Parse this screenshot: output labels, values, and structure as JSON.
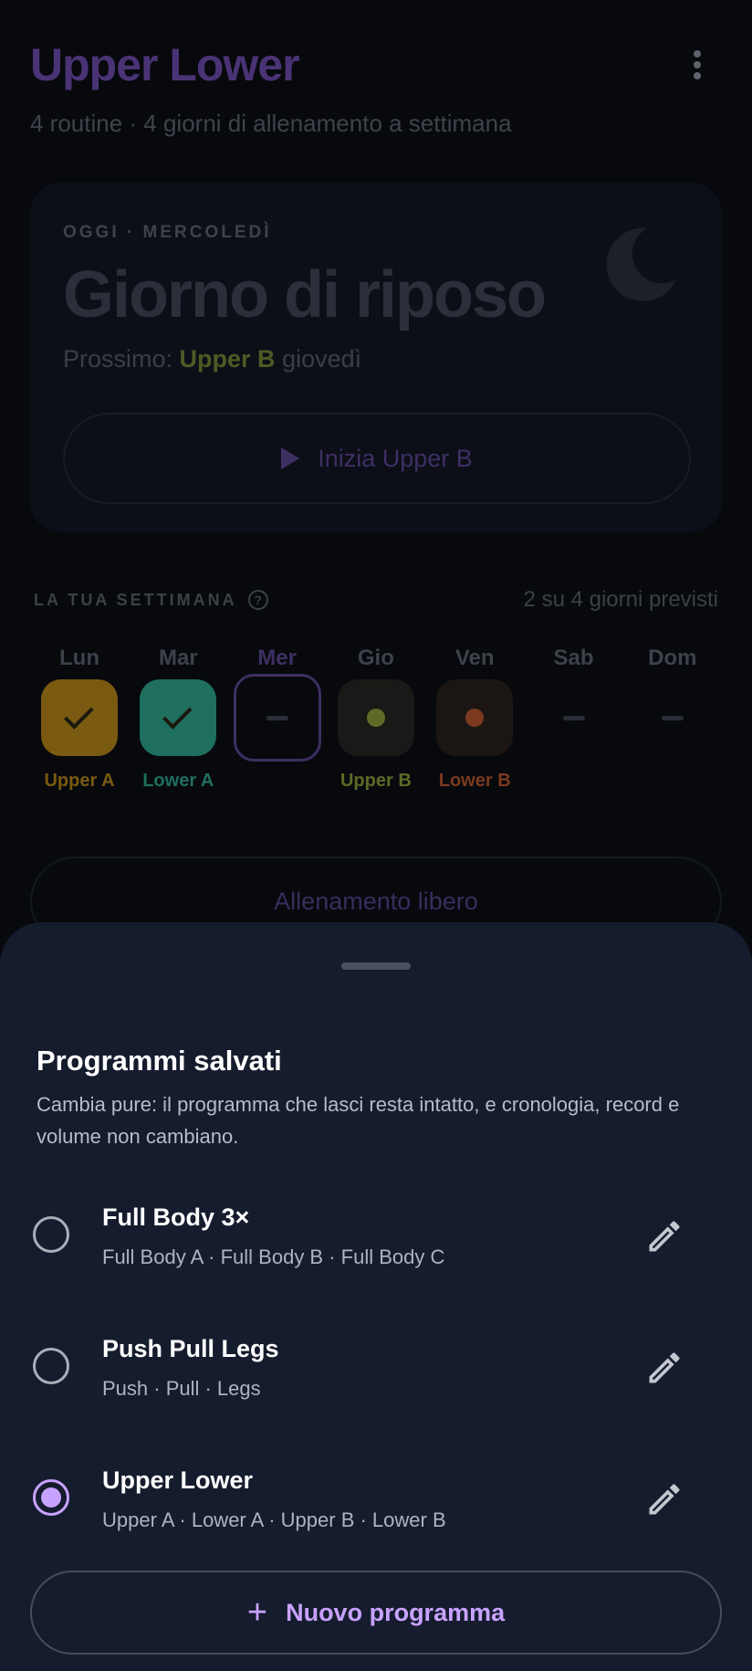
{
  "header": {
    "title": "Upper Lower",
    "subtitle": "4 routine · 4 giorni di allenamento a settimana",
    "menu_icon": "more-vert-icon"
  },
  "today": {
    "label": "OGGI · MERCOLEDÌ",
    "title": "Giorno di riposo",
    "next_prefix": "Prossimo:",
    "next_routine": "Upper B",
    "next_day": "giovedì",
    "start_label": "Inizia Upper B",
    "icon": "moon-icon"
  },
  "week": {
    "label": "LA TUA SETTIMANA",
    "help_icon": "?",
    "count": "2 su 4 giorni previsti",
    "days": [
      {
        "name": "Lun",
        "tag": "Upper A",
        "state": "done",
        "color": "#7a5a10",
        "tag_color": "#7a5a10"
      },
      {
        "name": "Mar",
        "tag": "Lower A",
        "state": "done",
        "color": "#1f6f5e",
        "tag_color": "#1f6f5e"
      },
      {
        "name": "Mer",
        "tag": "",
        "state": "today",
        "color": "#3e2f63",
        "tag_color": ""
      },
      {
        "name": "Gio",
        "tag": "Upper B",
        "state": "planned",
        "color": "#5d6a27",
        "tag_color": "#5d6a27"
      },
      {
        "name": "Ven",
        "tag": "Lower B",
        "state": "planned",
        "color": "#7b3a1f",
        "tag_color": "#7b3a1f"
      },
      {
        "name": "Sab",
        "tag": "",
        "state": "rest",
        "color": "",
        "tag_color": ""
      },
      {
        "name": "Dom",
        "tag": "",
        "state": "rest",
        "color": "",
        "tag_color": ""
      }
    ]
  },
  "free_workout_label": "Allenamento libero",
  "sheet": {
    "title": "Programmi salvati",
    "description": "Cambia pure: il programma che lasci resta intatto, e cronologia, record e volume non cambiano.",
    "programs": [
      {
        "name": "Full Body 3×",
        "routines": "Full Body A · Full Body B · Full Body C",
        "selected": false
      },
      {
        "name": "Push Pull Legs",
        "routines": "Push · Pull · Legs",
        "selected": false
      },
      {
        "name": "Upper Lower",
        "routines": "Upper A · Lower A · Upper B · Lower B",
        "selected": true
      }
    ],
    "new_label": "Nuovo programma",
    "accent": "#c8a2ff"
  }
}
